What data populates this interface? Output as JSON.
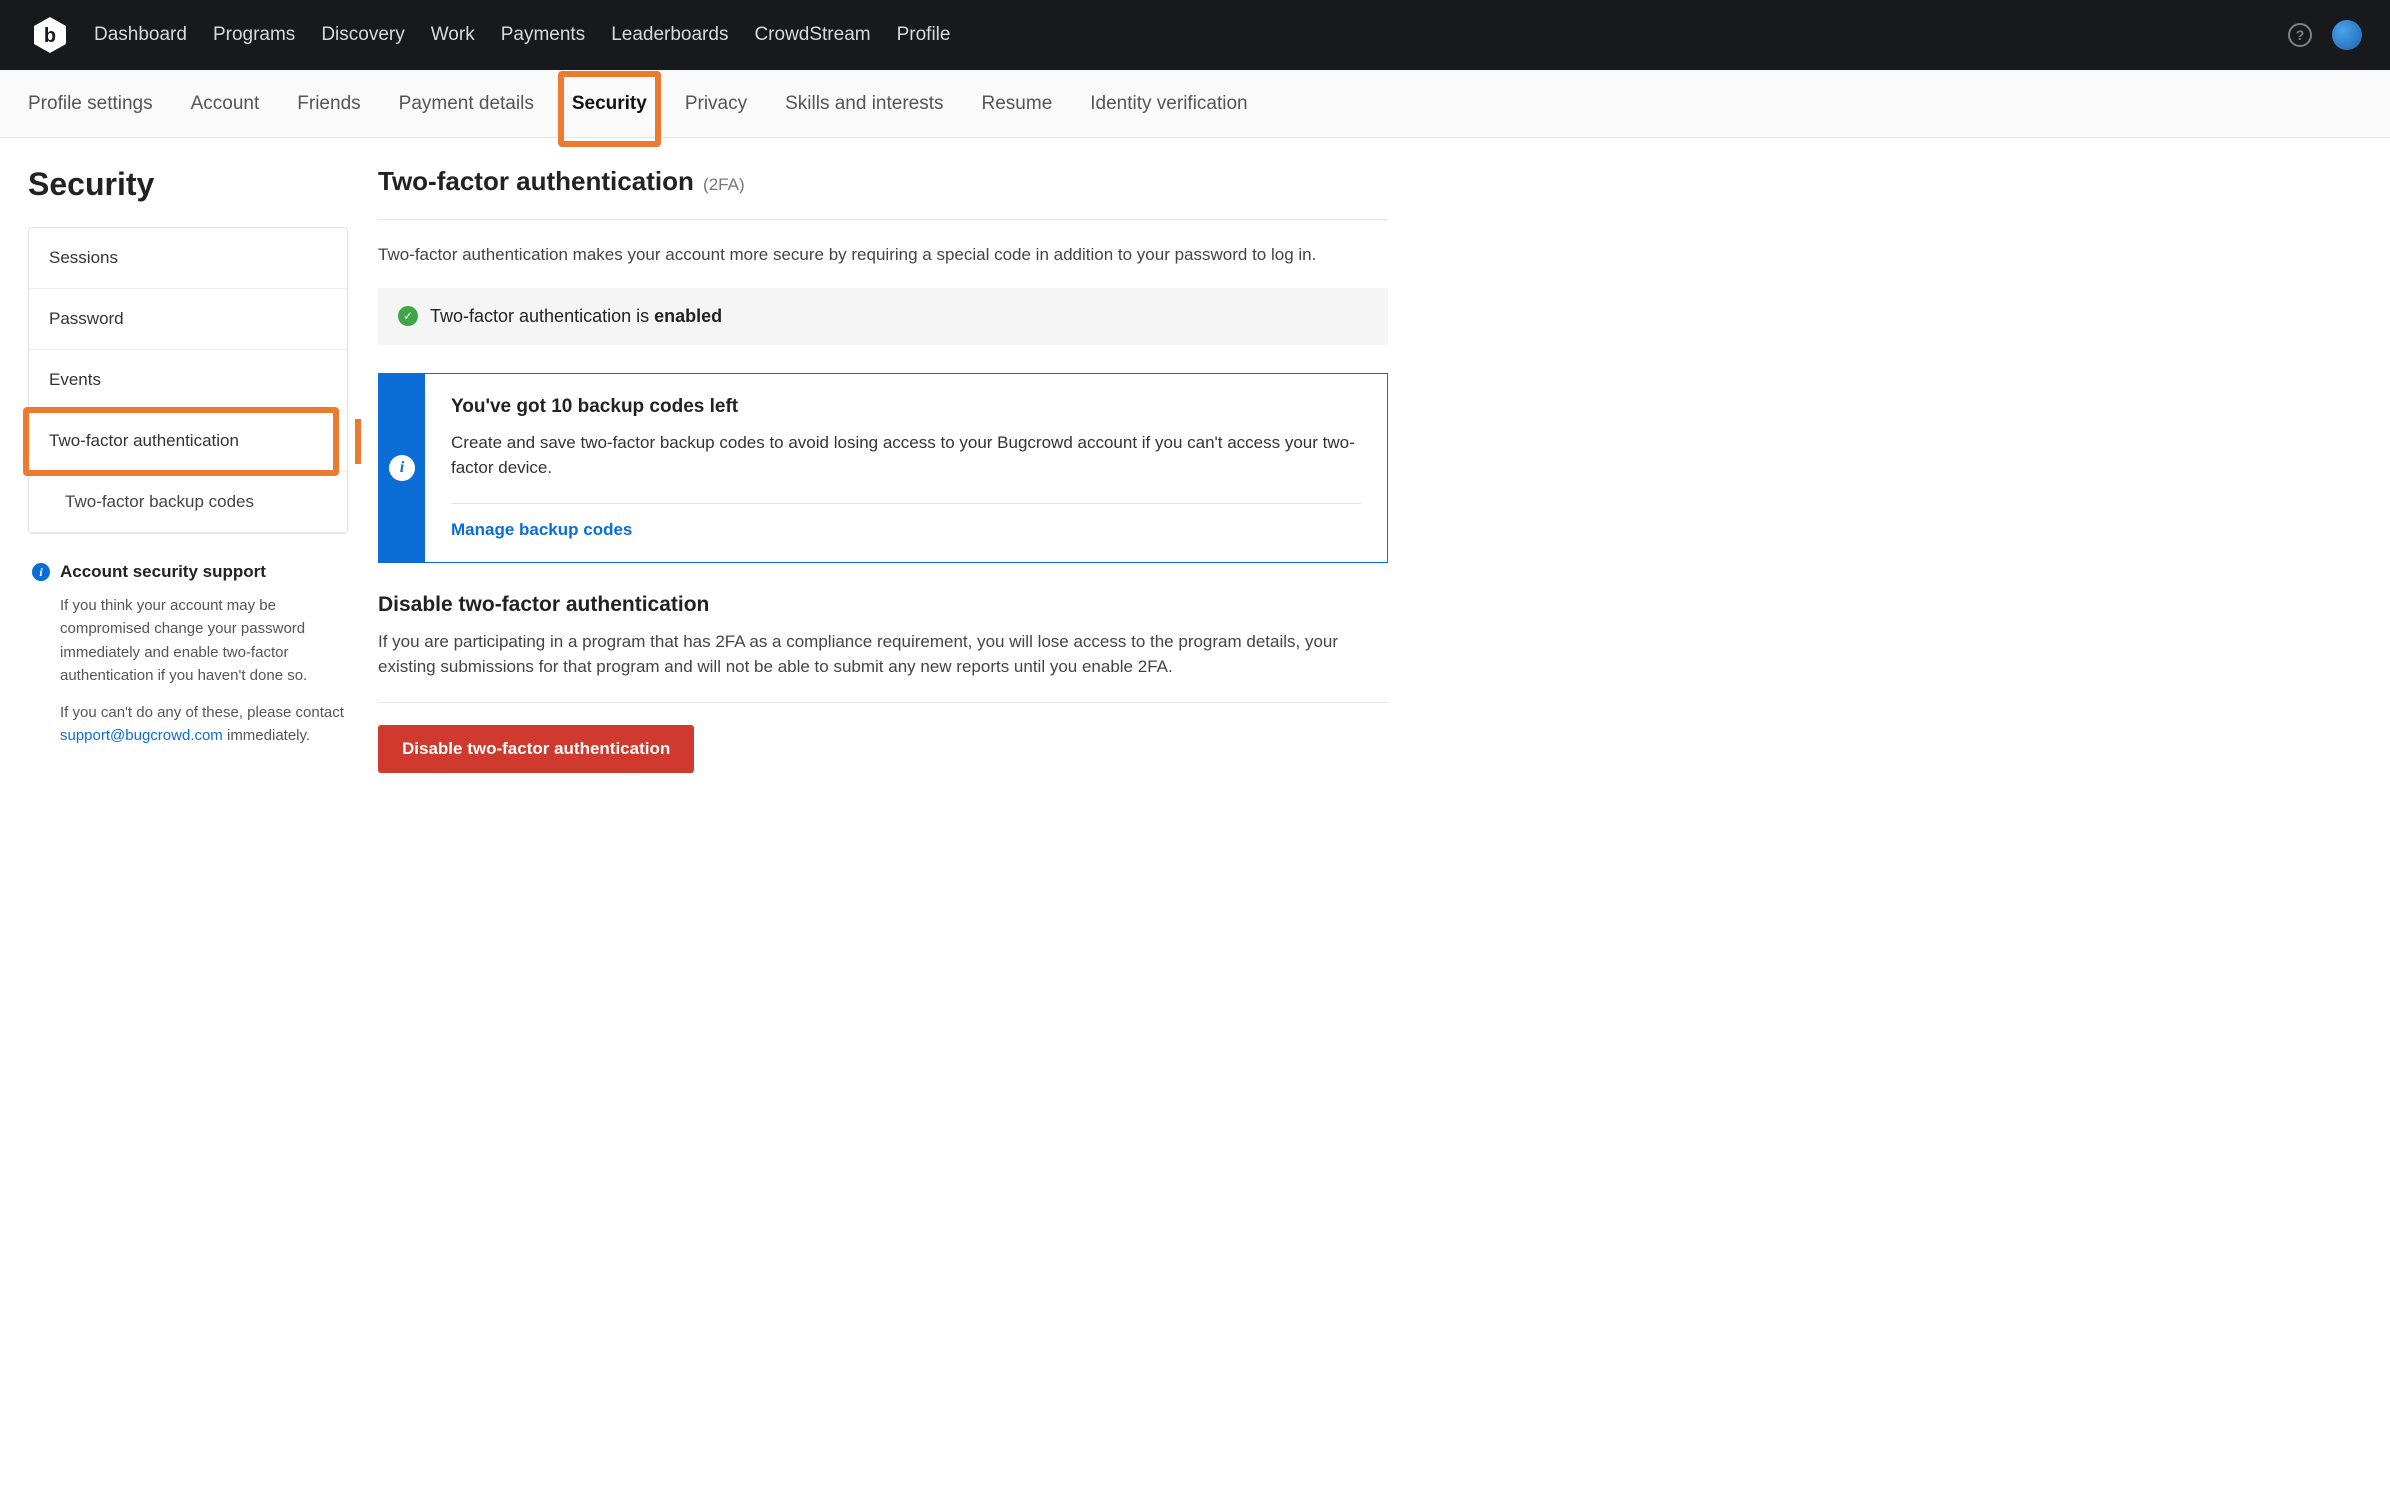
{
  "topnav": {
    "items": [
      "Dashboard",
      "Programs",
      "Discovery",
      "Work",
      "Payments",
      "Leaderboards",
      "CrowdStream",
      "Profile"
    ]
  },
  "subnav": {
    "items": [
      "Profile settings",
      "Account",
      "Friends",
      "Payment details",
      "Security",
      "Privacy",
      "Skills and interests",
      "Resume",
      "Identity verification"
    ],
    "activeIndex": 4
  },
  "page": {
    "title": "Security"
  },
  "sidebar": {
    "items": [
      {
        "label": "Sessions"
      },
      {
        "label": "Password"
      },
      {
        "label": "Events"
      },
      {
        "label": "Two-factor authentication",
        "active": true
      },
      {
        "label": "Two-factor backup codes",
        "sub": true
      }
    ]
  },
  "support": {
    "heading": "Account security support",
    "p1": "If you think your account may be compromised change your password immediately and enable two-factor authentication if you haven't done so.",
    "p2_prefix": "If you can't do any of these, please contact ",
    "email": "support@bugcrowd.com",
    "p2_suffix": " immediately."
  },
  "main": {
    "title": "Two-factor authentication",
    "title_tag": "(2FA)",
    "intro": "Two-factor authentication makes your account more secure by requiring a special code in addition to your password to log in.",
    "status_prefix": "Two-factor authentication is ",
    "status_word": "enabled",
    "backup": {
      "heading": "You've got 10 backup codes left",
      "body": "Create and save two-factor backup codes to avoid losing access to your Bugcrowd account if you can't access your two-factor device.",
      "link": "Manage backup codes"
    },
    "disable": {
      "heading": "Disable two-factor authentication",
      "body": "If you are participating in a program that has 2FA as a compliance requirement, you will lose access to the program details, your existing submissions for that program and will not be able to submit any new reports until you enable 2FA.",
      "button": "Disable two-factor authentication"
    }
  }
}
